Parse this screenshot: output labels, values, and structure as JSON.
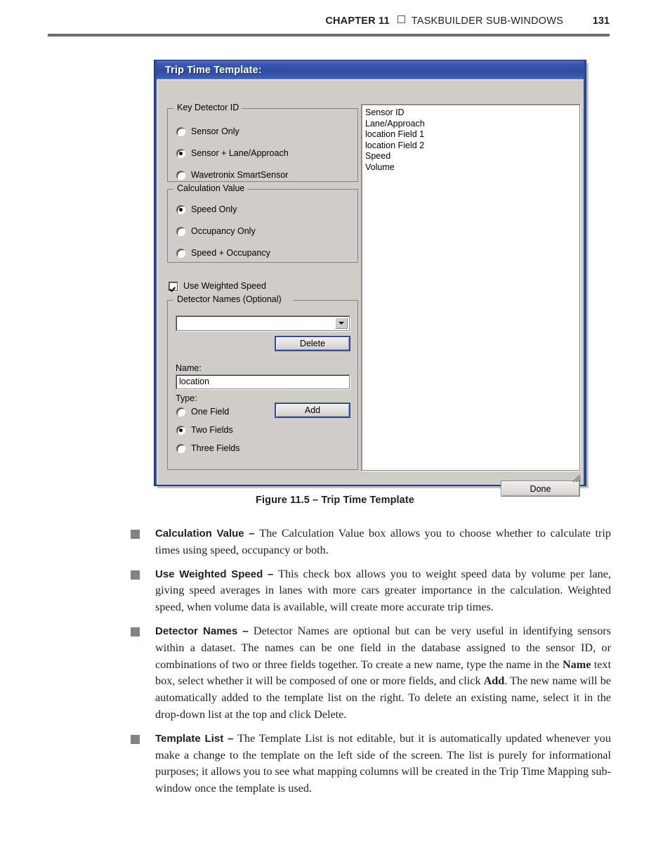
{
  "page": {
    "header": {
      "chapter": "CHAPTER 11",
      "separator_icon": "square-icon",
      "title": "TASKBUILDER SUB-WINDOWS",
      "page_number": "131"
    },
    "figure_caption": "Figure 11.5 – Trip Time Template"
  },
  "dialog": {
    "title": "Trip Time Template:",
    "key_detector_id": {
      "legend": "Key Detector ID",
      "options": [
        {
          "label": "Sensor Only",
          "checked": false
        },
        {
          "label": "Sensor + Lane/Approach",
          "checked": true
        },
        {
          "label": "Wavetronix SmartSensor",
          "checked": false
        }
      ]
    },
    "calculation_value": {
      "legend": "Calculation Value",
      "options": [
        {
          "label": "Speed Only",
          "checked": true
        },
        {
          "label": "Occupancy Only",
          "checked": false
        },
        {
          "label": "Speed + Occupancy",
          "checked": false
        }
      ]
    },
    "use_weighted_speed": {
      "label": "Use Weighted Speed",
      "checked": true
    },
    "detector_names": {
      "legend": "Detector Names (Optional)",
      "combo_value": "",
      "delete_label": "Delete",
      "name_label": "Name:",
      "name_value": "location",
      "type_label": "Type:",
      "add_label": "Add",
      "type_options": [
        {
          "label": "One Field",
          "checked": false
        },
        {
          "label": "Two Fields",
          "checked": true
        },
        {
          "label": "Three Fields",
          "checked": false
        }
      ]
    },
    "template_list": {
      "items": [
        "Sensor ID",
        "Lane/Approach",
        "location Field 1",
        "location Field 2",
        "Speed",
        "Volume"
      ]
    },
    "done_label": "Done"
  },
  "body": {
    "bullets": [
      {
        "term": "Calculation Value – ",
        "text": "The Calculation Value box allows you to choose whether to calculate trip times using speed, occupancy or both."
      },
      {
        "term": "Use Weighted Speed – ",
        "text": "This check box allows you to weight speed data by volume per lane, giving speed averages in lanes with more cars greater importance in the calculation. Weighted speed, when volume data is available, will create more accurate trip times."
      },
      {
        "term": "Detector Names – ",
        "text_part1": "Detector Names are optional but can be very useful in identifying sensors within a dataset. The names can be one field in the database assigned to the sensor ID, or combinations of two or three fields together. To create a new name, type the name in the ",
        "emphasis1": "Name",
        "text_part2": " text box, select whether it will be composed of one or more fields, and click ",
        "emphasis2": "Add",
        "text_part3": ". The new name will be automatically added to the template list on the right. To delete an existing name, select it in the drop-down list at the top and click Delete."
      },
      {
        "term": "Template List – ",
        "text": "The Template List is not editable, but it is automatically updated whenever you make a change to the template on the left side of the screen. The list is purely for informational purposes; it allows you to see what mapping columns will be created in the Trip Time Mapping sub-window once the template is used."
      }
    ]
  },
  "colors": {
    "titlebar_blue": "#2f4ba0",
    "dialog_face": "#d0ccc8",
    "rule_gray": "#6d6e71",
    "bullet_gray": "#808285",
    "text_black": "#231f20"
  }
}
